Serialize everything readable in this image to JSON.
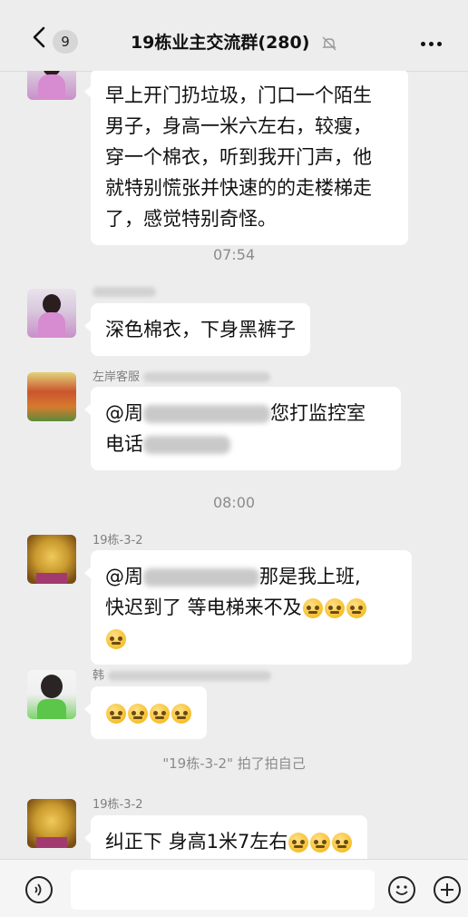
{
  "header": {
    "unread_count": "9",
    "title": "19栋业主交流群(280)"
  },
  "messages": [
    {
      "lines": [
        "早上开门扔垃圾，门口一个陌生",
        "男子，身高一米六左右，较瘦，",
        "穿一个棉衣，听到我开门声，他",
        "就特别慌张并快速的的走楼梯走",
        "了，感觉特别奇怪。"
      ]
    },
    {
      "time": "07:54"
    },
    {
      "text": "深色棉衣，下身黑裤子"
    },
    {
      "sender_prefix": "左岸客服",
      "line1_prefix": "@周",
      "line1_suffix": "您打监控室",
      "line2_prefix": "电话"
    },
    {
      "time": "08:00"
    },
    {
      "sender": "19栋-3-2",
      "line1_prefix": "@周",
      "line1_suffix": "那是我上班,",
      "line2": "快迟到了 等电梯来不及"
    },
    {
      "sender_prefix": "韩"
    },
    {
      "system": "\"19栋-3-2\" 拍了拍自己"
    },
    {
      "sender": "19栋-3-2",
      "text": "纠正下 身高1米7左右"
    }
  ],
  "icons": {
    "back": "chevron-left-icon",
    "mute": "mute-bell-icon",
    "more": "more-dots-icon",
    "voice": "voice-icon",
    "emoji": "emoji-icon",
    "plus": "plus-icon"
  },
  "colors": {
    "background": "#ededed",
    "bubble": "#ffffff",
    "meta_text": "#8b8b8b"
  }
}
